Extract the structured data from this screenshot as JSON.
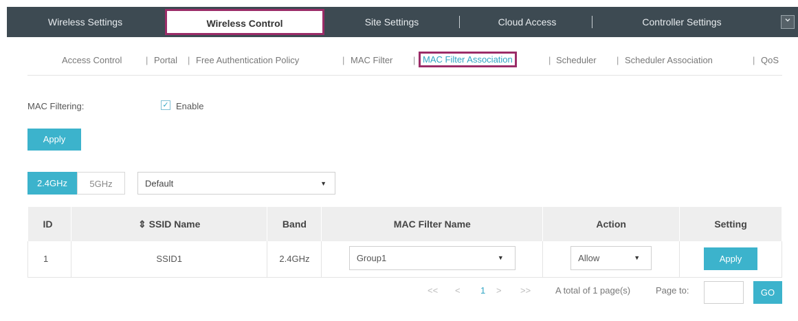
{
  "topnav": {
    "tabs": [
      {
        "label": "Wireless Settings"
      },
      {
        "label": "Wireless Control"
      },
      {
        "label": "Site Settings"
      },
      {
        "label": "Cloud Access"
      },
      {
        "label": "Controller Settings"
      }
    ],
    "active_tab": "Wireless Control",
    "menu_icon": "chevron-down-icon"
  },
  "subnav": {
    "items": [
      {
        "label": "Access Control"
      },
      {
        "label": "Portal"
      },
      {
        "label": "Free Authentication Policy"
      },
      {
        "label": "MAC Filter"
      },
      {
        "label": "MAC Filter Association"
      },
      {
        "label": "Scheduler"
      },
      {
        "label": "Scheduler Association"
      },
      {
        "label": "QoS"
      }
    ],
    "separator": "|",
    "active_item": "MAC Filter Association"
  },
  "form": {
    "mac_filtering_label": "MAC Filtering:",
    "enable_label": "Enable",
    "enable_checked": true,
    "apply_label": "Apply"
  },
  "band": {
    "options": [
      "2.4GHz",
      "5GHz"
    ],
    "selected": "2.4GHz",
    "group_select": "Default"
  },
  "table": {
    "headers": [
      "ID",
      "SSID Name",
      "Band",
      "MAC Filter Name",
      "Action",
      "Setting"
    ],
    "sort_icon": "sort-icon",
    "sort_glyph": "⇕",
    "rows": [
      {
        "id": "1",
        "ssid": "SSID1",
        "band": "2.4GHz",
        "mac_filter": "Group1",
        "action": "Allow",
        "setting": "Apply"
      }
    ]
  },
  "pagination": {
    "first": "<<",
    "prev": "<",
    "current": "1",
    "next": ">",
    "last": ">>",
    "total_text": "A total of 1 page(s)",
    "page_to_label": "Page to:",
    "page_input": "",
    "go_label": "GO"
  },
  "colors": {
    "nav_bg": "#3d4a52",
    "accent": "#3cb3cc",
    "highlight": "#9b2c68"
  },
  "caret_glyph": "▼",
  "check_glyph": "✓"
}
